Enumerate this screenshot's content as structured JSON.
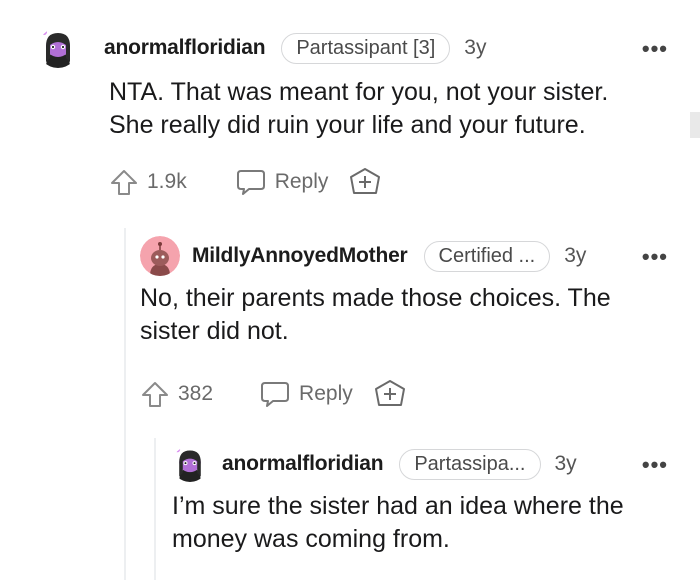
{
  "comments": [
    {
      "username": "anormalfloridian",
      "flair": "Partassipant [3]",
      "time": "3y",
      "more": "•••",
      "body_lines": [
        "NTA. That was meant for you, not your sister.",
        "She really did ruin your life and your future."
      ],
      "votes": "1.9k",
      "reply_label": "Reply"
    },
    {
      "username": "MildlyAnnoyedMother",
      "flair": "Certified ...",
      "time": "3y",
      "more": "•••",
      "body_lines": [
        "No, their parents made those choices. The",
        "sister did not."
      ],
      "votes": "382",
      "reply_label": "Reply"
    },
    {
      "username": "anormalfloridian",
      "flair": "Partassipa...",
      "time": "3y",
      "more": "•••",
      "body_lines": [
        "I’m sure the sister had an idea where the",
        "money was coming from."
      ]
    }
  ],
  "icons": {
    "upvote": "upvote-arrow-icon",
    "reply": "speech-bubble-icon",
    "award": "add-award-icon",
    "more": "more-options-icon"
  },
  "colors": {
    "avatar_purple": "#b16fd6",
    "avatar_pink": "#f5a3ad",
    "thread_line": "#edeff1"
  }
}
